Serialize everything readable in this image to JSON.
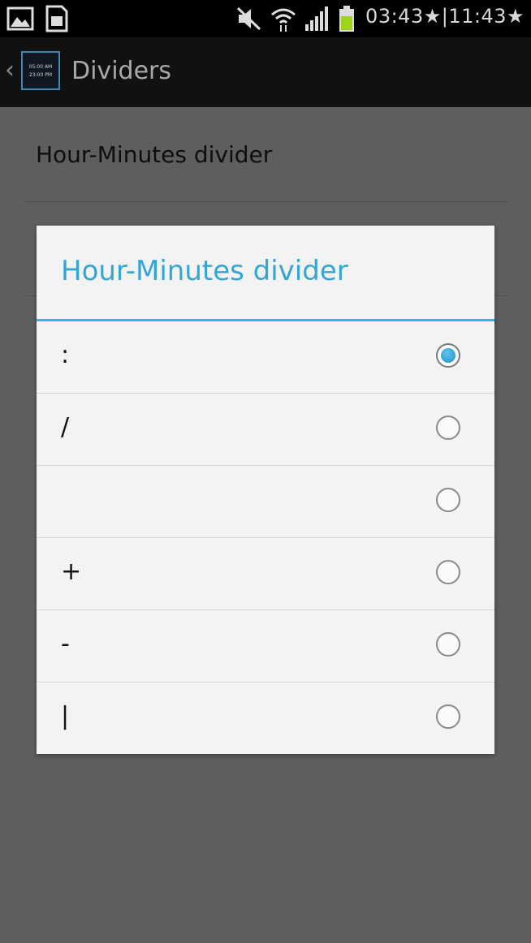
{
  "status_bar": {
    "icons": [
      "gallery-icon",
      "sd-card-icon",
      "mute-icon",
      "wifi-icon",
      "signal-icon",
      "battery-icon"
    ],
    "time": "03:43★|11:43★"
  },
  "action_bar": {
    "title": "Dividers",
    "app_icon_line1": "05:00 AM",
    "app_icon_line2": "23:00 PM"
  },
  "preferences": {
    "item_title": "Hour-Minutes divider"
  },
  "dialog": {
    "title": "Hour-Minutes divider",
    "accent_color": "#33b5e5",
    "selected_index": 0,
    "options": [
      {
        "label": ":",
        "checked": true
      },
      {
        "label": "/",
        "checked": false
      },
      {
        "label": "",
        "checked": false
      },
      {
        "label": "+",
        "checked": false
      },
      {
        "label": "-",
        "checked": false
      },
      {
        "label": "|",
        "checked": false
      }
    ]
  }
}
